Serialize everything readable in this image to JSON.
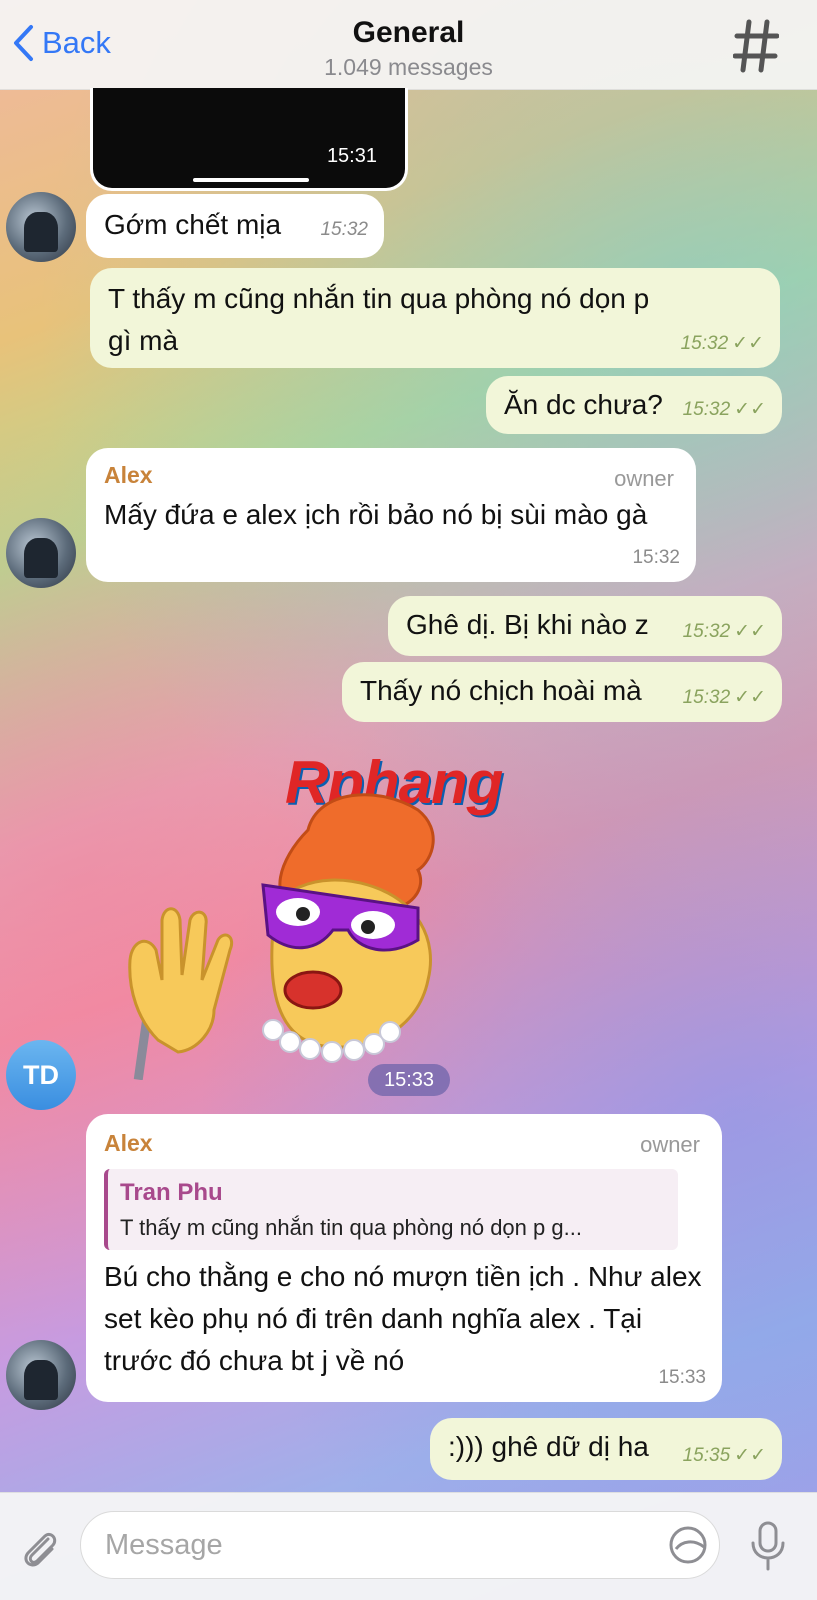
{
  "header": {
    "back_label": "Back",
    "title": "General",
    "subtitle": "1.049 messages"
  },
  "messages": [
    {
      "text": "",
      "time": "15:31"
    },
    {
      "text": "Gớm chết mịa",
      "time": "15:32"
    },
    {
      "text": "T thấy m cũng nhắn tin qua phòng nó dọn p gì mà",
      "time": "15:32"
    },
    {
      "text": "Ăn dc chưa?",
      "time": "15:32"
    },
    {
      "sender": "Alex",
      "role": "owner",
      "text": "Mấy đứa e alex ịch rồi bảo nó bị sùi mào gà",
      "time": "15:32"
    },
    {
      "text": "Ghê dị. Bị khi nào z",
      "time": "15:32"
    },
    {
      "text": "Thấy nó chịch hoài mà",
      "time": "15:32"
    },
    {
      "text": "",
      "time": "15:33"
    },
    {
      "sender": "Alex",
      "role": "owner",
      "reply_name": "Tran Phu",
      "reply_text": "T thấy m cũng nhắn tin qua phòng nó dọn p g...",
      "text": "Bú cho thằng e cho nó mượn tiền ịch . Như alex set kèo phụ nó đi trên danh nghĩa alex . Tại trước đó chưa bt j về nó",
      "time": "15:33"
    },
    {
      "text": ":))) ghê dữ dị ha",
      "time": "15:35"
    }
  ],
  "avatars": {
    "td_initials": "TD"
  },
  "watermark": "Rphang",
  "input": {
    "placeholder": "Message"
  }
}
